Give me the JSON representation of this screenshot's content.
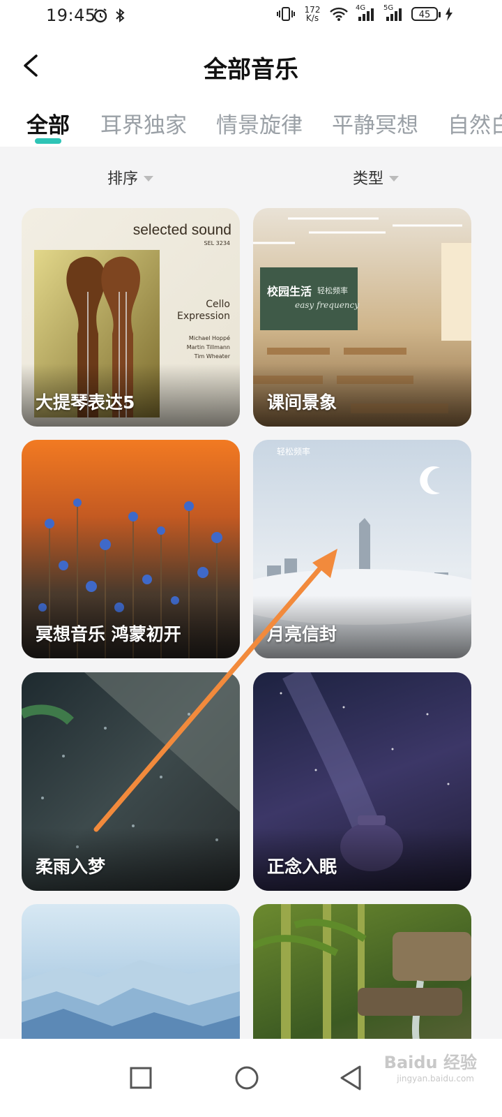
{
  "status_bar": {
    "time": "19:45",
    "net_speed_value": "172",
    "net_speed_unit": "K/s",
    "net_4g": "4G",
    "net_5g": "5G",
    "battery": "45"
  },
  "header": {
    "title": "全部音乐"
  },
  "tabs": [
    {
      "label": "全部",
      "active": true
    },
    {
      "label": "耳界独家"
    },
    {
      "label": "情景旋律"
    },
    {
      "label": "平静冥想"
    },
    {
      "label": "自然白"
    }
  ],
  "filters": {
    "sort_label": "排序",
    "type_label": "类型"
  },
  "cards": [
    {
      "title": "大提琴表达5",
      "art": {
        "brand": "selected sound",
        "catalog": "SEL 3234",
        "album": "Cello",
        "album2": "Expression",
        "artists": [
          "Michael Hoppé",
          "Martin Tillmann",
          "Tim Wheater"
        ]
      }
    },
    {
      "title": "课间景象",
      "art": {
        "board_text": "校园生活",
        "board_sub": "轻松频率",
        "board_script": "easy frequency"
      }
    },
    {
      "title": "冥想音乐 鸿蒙初开"
    },
    {
      "title": "月亮信封",
      "art": {
        "brand": "轻松频率"
      }
    },
    {
      "title": "柔雨入梦"
    },
    {
      "title": "正念入眠"
    },
    {
      "title": ""
    },
    {
      "title": ""
    }
  ],
  "colors": {
    "accent": "#2ec4b6",
    "annotation_arrow": "#f28a3c"
  },
  "watermark": "Baidu 经验",
  "watermark_url": "jingyan.baidu.com"
}
